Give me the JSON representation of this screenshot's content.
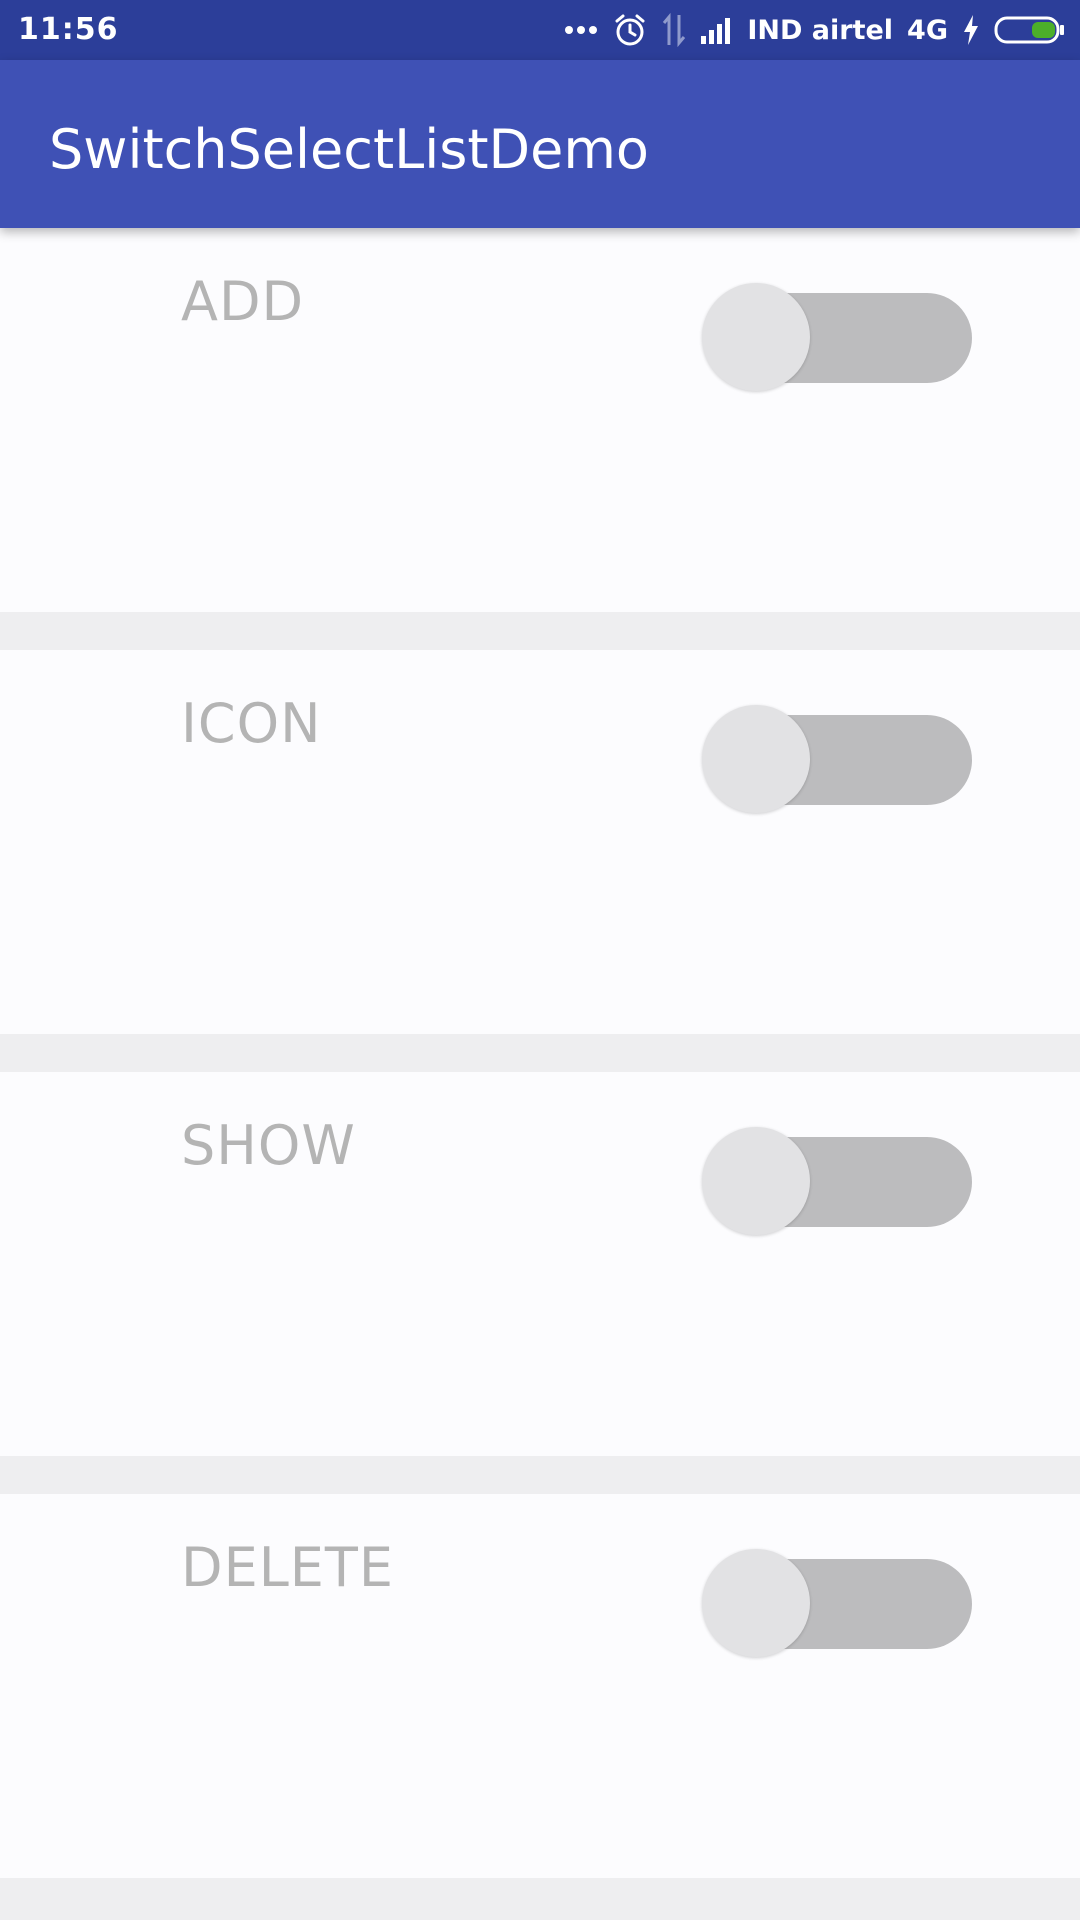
{
  "status_bar": {
    "time": "11:56",
    "carrier": "IND airtel",
    "network": "4G",
    "icons": [
      "more-dots-icon",
      "alarm-icon",
      "data-transfer-icon",
      "signal-icon",
      "charging-icon",
      "battery-icon"
    ],
    "battery_color": "#4caf2a"
  },
  "app_bar": {
    "title": "SwitchSelectListDemo",
    "color": "#3f51b5"
  },
  "list": {
    "items": [
      {
        "label": "ADD",
        "checked": false
      },
      {
        "label": "ICON",
        "checked": false
      },
      {
        "label": "SHOW",
        "checked": false
      },
      {
        "label": "DELETE",
        "checked": false
      }
    ]
  }
}
